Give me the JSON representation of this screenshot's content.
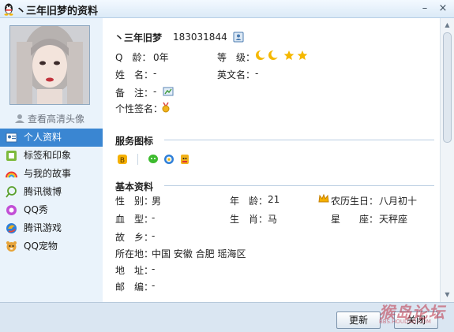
{
  "window": {
    "title": "丶三年旧梦的资料",
    "minimize_glyph": "–",
    "close_glyph": "×"
  },
  "left": {
    "hd_link": "查看高清头像",
    "nav": [
      {
        "label": "个人资料",
        "icon": "id-card-icon",
        "active": true
      },
      {
        "label": "标签和印象",
        "icon": "tag-icon",
        "active": false
      },
      {
        "label": "与我的故事",
        "icon": "rainbow-icon",
        "active": false
      },
      {
        "label": "腾讯微博",
        "icon": "weibo-icon",
        "active": false
      },
      {
        "label": "QQ秀",
        "icon": "qq-show-icon",
        "active": false
      },
      {
        "label": "腾讯游戏",
        "icon": "game-icon",
        "active": false
      },
      {
        "label": "QQ宠物",
        "icon": "pet-icon",
        "active": false
      }
    ]
  },
  "profile": {
    "nickname": "丶三年旧梦",
    "qq_number": "183031844",
    "age_label": "Q　龄：",
    "age_value": "0年",
    "level_label": "等　级：",
    "name_label": "姓　名：",
    "name_value": "-",
    "english_label": "英文名：",
    "english_value": "-",
    "remark_label": "备　注：",
    "remark_value": "-",
    "signature_label": "个性签名："
  },
  "services": {
    "title": "服务图标"
  },
  "basic": {
    "title": "基本资料",
    "gender_label": "性　别：",
    "gender_value": "男",
    "age2_label": "年　龄：",
    "age2_value": "21",
    "lunar_label": "农历生日：",
    "lunar_value": "八月初十",
    "blood_label": "血　型：",
    "blood_value": "-",
    "zodiac_label": "生　肖：",
    "zodiac_value": "马",
    "star_label": "星　　座：",
    "star_value": "天秤座",
    "hometown_label": "故　乡：",
    "hometown_value": "-",
    "location_label": "所在地：",
    "location_value": "中国 安徽 合肥 瑶海区",
    "address_label": "地　址：",
    "address_value": "-",
    "zip_label": "邮　编：",
    "zip_value": "-"
  },
  "buttons": {
    "refresh": "更新",
    "close": "关闭"
  },
  "watermark": {
    "main": "猴岛论坛",
    "sub": "BBS.HOUDAO.COM"
  },
  "colors": {
    "accent": "#3a86d2",
    "panel": "#eaf3fb",
    "bottom": "#dae6f2"
  }
}
